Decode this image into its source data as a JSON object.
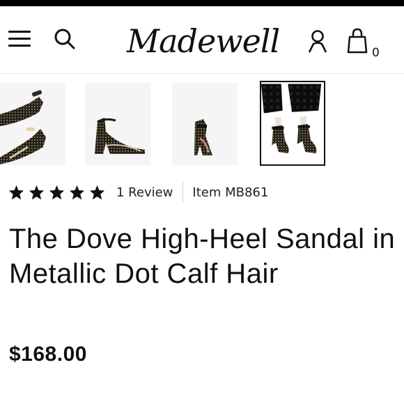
{
  "brand": {
    "logo_text": "Madewell"
  },
  "header": {
    "icons": [
      "menu-icon",
      "search-icon",
      "account-icon",
      "shopping-bag-icon"
    ],
    "bag_count": "0"
  },
  "gallery": {
    "thumbnails": [
      {
        "name": "product-thumbnail-1",
        "selected": false
      },
      {
        "name": "product-thumbnail-2",
        "selected": false
      },
      {
        "name": "product-thumbnail-3",
        "selected": false
      },
      {
        "name": "product-thumbnail-4",
        "selected": true
      }
    ]
  },
  "product": {
    "rating": 5,
    "rating_max": 5,
    "review_text": "1 Review",
    "item_text": "Item MB861",
    "title": "The Dove High-Heel Sandal in Metallic Dot Calf Hair",
    "price": "$168.00"
  },
  "colors": {
    "text": "#111111",
    "top_bar": "#000000",
    "divider": "#cfcfcf"
  }
}
